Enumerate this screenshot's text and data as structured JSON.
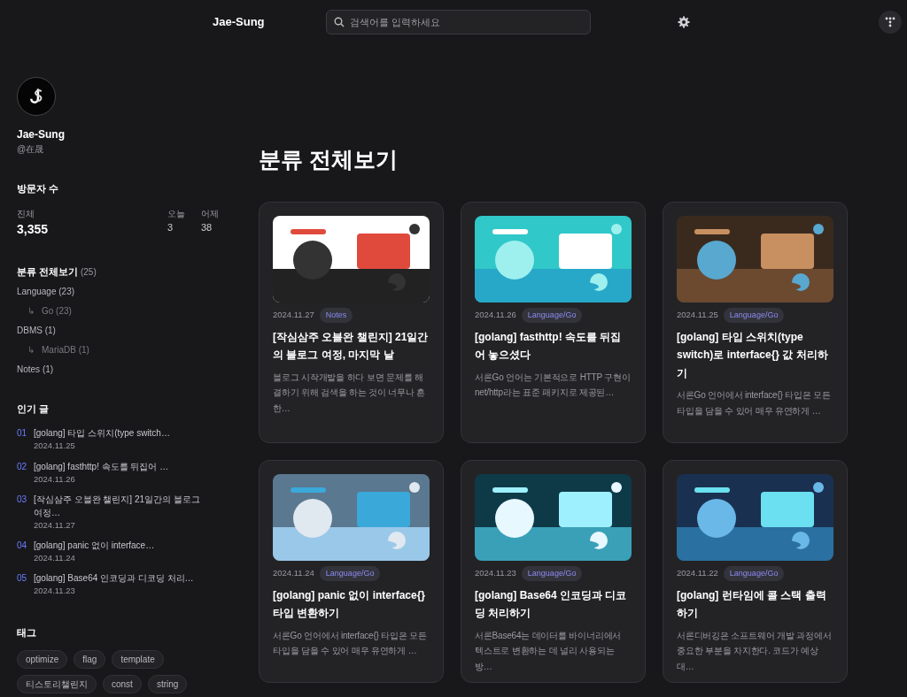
{
  "header": {
    "brand": "Jae-Sung",
    "search": {
      "placeholder": "검색어를 입력하세요"
    }
  },
  "profile": {
    "name": "Jae-Sung",
    "handle": "@在晟"
  },
  "visitors": {
    "title": "방문자 수",
    "total_label": "진체",
    "total": "3,355",
    "today_label": "오늘",
    "today": "3",
    "yesterday_label": "어제",
    "yesterday": "38"
  },
  "categories": {
    "title": "분류 전체보기",
    "count": "(25)",
    "items": [
      {
        "label": "Language",
        "count": "(23)",
        "children": [
          {
            "branch": "↳",
            "label": "Go",
            "count": "(23)"
          }
        ]
      },
      {
        "label": "DBMS",
        "count": "(1)",
        "children": [
          {
            "branch": "↳",
            "label": "MariaDB",
            "count": "(1)"
          }
        ]
      },
      {
        "label": "Notes",
        "count": "(1)"
      }
    ]
  },
  "popular": {
    "title": "인기 글",
    "items": [
      {
        "rank": "01",
        "title": "[golang] 타입 스위치(type switch…",
        "date": "2024.11.25"
      },
      {
        "rank": "02",
        "title": "[golang] fasthttp! 속도를 뒤집어 …",
        "date": "2024.11.26"
      },
      {
        "rank": "03",
        "title": "[작심삼주 오블완 챌린지] 21일간의 블로그 여정…",
        "date": "2024.11.27"
      },
      {
        "rank": "04",
        "title": "[golang] panic 없이 interface…",
        "date": "2024.11.24"
      },
      {
        "rank": "05",
        "title": "[golang] Base64 인코딩과 디코딩 처리…",
        "date": "2024.11.23"
      }
    ]
  },
  "tags": {
    "title": "태그",
    "items": [
      "optimize",
      "flag",
      "template",
      "티스토리챌린지",
      "const",
      "string"
    ]
  },
  "main": {
    "heading": "분류 전체보기",
    "posts": [
      {
        "date": "2024.11.27",
        "category": "Notes",
        "title": "[작심삼주 오블완 챌린지] 21일간의 블로그 여정, 마지막 날",
        "excerpt": "블로그 시작개발을 하다 보면 문제를 해결하기 위해 검색을 하는 것이 너무나 흔한…"
      },
      {
        "date": "2024.11.26",
        "category": "Language/Go",
        "title": "[golang] fasthttp! 속도를 뒤집어 놓으셨다",
        "excerpt": "서론Go 언어는 기본적으로 HTTP 구현이 net/http라는 표준 패키지로 제공된…"
      },
      {
        "date": "2024.11.25",
        "category": "Language/Go",
        "title": "[golang] 타입 스위치(type switch)로 interface{} 값 처리하기",
        "excerpt": "서론Go 언어에서 interface{} 타입은 모든 타입을 담을 수 있어 매우 유연하게 …"
      },
      {
        "date": "2024.11.24",
        "category": "Language/Go",
        "title": "[golang] panic 없이 interface{} 타입 변환하기",
        "excerpt": "서론Go 언어에서 interface{} 타입은 모든 타입을 담을 수 있어 매우 유연하게 …"
      },
      {
        "date": "2024.11.23",
        "category": "Language/Go",
        "title": "[golang] Base64 인코딩과 디코딩 처리하기",
        "excerpt": "서론Base64는 데이터를 바이너리에서 텍스트로 변환하는 데 널리 사용되는 방…"
      },
      {
        "date": "2024.11.22",
        "category": "Language/Go",
        "title": "[golang] 런타임에 콜 스택 출력하기",
        "excerpt": "서론디버깅은 소프트웨어 개발 과정에서 중요한 부분을 차지한다. 코드가 예상대…"
      }
    ]
  }
}
